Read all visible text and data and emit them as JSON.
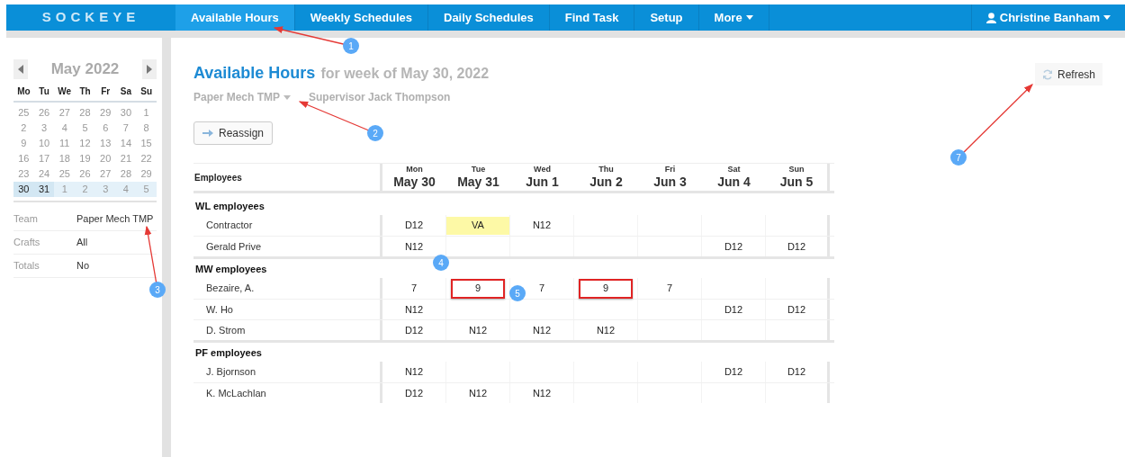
{
  "brand": "SOCKEYE",
  "nav": [
    {
      "label": "Available Hours",
      "selected": true
    },
    {
      "label": "Weekly Schedules",
      "selected": false
    },
    {
      "label": "Daily Schedules",
      "selected": false
    },
    {
      "label": "Find Task",
      "selected": false
    },
    {
      "label": "Setup",
      "selected": false
    },
    {
      "label": "More",
      "selected": false,
      "dropdown": true
    }
  ],
  "user": {
    "name": "Christine Banham"
  },
  "calendar": {
    "month": "May 2022",
    "weekdays": [
      "Mo",
      "Tu",
      "We",
      "Th",
      "Fr",
      "Sa",
      "Su"
    ],
    "weeks": [
      {
        "selected": false,
        "days": [
          {
            "text": "25",
            "emphasized": false
          },
          {
            "text": "26",
            "emphasized": false
          },
          {
            "text": "27",
            "emphasized": false
          },
          {
            "text": "28",
            "emphasized": false
          },
          {
            "text": "29",
            "emphasized": false
          },
          {
            "text": "30",
            "emphasized": false
          },
          {
            "text": "1",
            "emphasized": false
          }
        ]
      },
      {
        "selected": false,
        "days": [
          {
            "text": "2",
            "emphasized": false
          },
          {
            "text": "3",
            "emphasized": false
          },
          {
            "text": "4",
            "emphasized": false
          },
          {
            "text": "5",
            "emphasized": false
          },
          {
            "text": "6",
            "emphasized": false
          },
          {
            "text": "7",
            "emphasized": false
          },
          {
            "text": "8",
            "emphasized": false
          }
        ]
      },
      {
        "selected": false,
        "days": [
          {
            "text": "9",
            "emphasized": false
          },
          {
            "text": "10",
            "emphasized": false
          },
          {
            "text": "11",
            "emphasized": false
          },
          {
            "text": "12",
            "emphasized": false
          },
          {
            "text": "13",
            "emphasized": false
          },
          {
            "text": "14",
            "emphasized": false
          },
          {
            "text": "15",
            "emphasized": false
          }
        ]
      },
      {
        "selected": false,
        "days": [
          {
            "text": "16",
            "emphasized": false
          },
          {
            "text": "17",
            "emphasized": false
          },
          {
            "text": "18",
            "emphasized": false
          },
          {
            "text": "19",
            "emphasized": false
          },
          {
            "text": "20",
            "emphasized": false
          },
          {
            "text": "21",
            "emphasized": false
          },
          {
            "text": "22",
            "emphasized": false
          }
        ]
      },
      {
        "selected": false,
        "days": [
          {
            "text": "23",
            "emphasized": false
          },
          {
            "text": "24",
            "emphasized": false
          },
          {
            "text": "25",
            "emphasized": false
          },
          {
            "text": "26",
            "emphasized": false
          },
          {
            "text": "27",
            "emphasized": false
          },
          {
            "text": "28",
            "emphasized": false
          },
          {
            "text": "29",
            "emphasized": false
          }
        ]
      },
      {
        "selected": true,
        "days": [
          {
            "text": "30",
            "emphasized": true
          },
          {
            "text": "31",
            "emphasized": true
          },
          {
            "text": "1",
            "emphasized": false
          },
          {
            "text": "2",
            "emphasized": false
          },
          {
            "text": "3",
            "emphasized": false
          },
          {
            "text": "4",
            "emphasized": false
          },
          {
            "text": "5",
            "emphasized": false
          }
        ]
      }
    ]
  },
  "filters": [
    {
      "label": "Team",
      "value": "Paper Mech TMP"
    },
    {
      "label": "Crafts",
      "value": "All"
    },
    {
      "label": "Totals",
      "value": "No"
    }
  ],
  "page": {
    "title": "Available Hours",
    "subtitle": "for week of May 30, 2022",
    "team": "Paper Mech TMP",
    "supervisor": "Supervisor Jack Thompson"
  },
  "reassign_button": "Reassign",
  "refresh_button": "Refresh",
  "table": {
    "name_column": "Employees",
    "days": [
      {
        "weekday": "Mon",
        "date": "May 30"
      },
      {
        "weekday": "Tue",
        "date": "May 31"
      },
      {
        "weekday": "Wed",
        "date": "Jun 1"
      },
      {
        "weekday": "Thu",
        "date": "Jun 2"
      },
      {
        "weekday": "Fri",
        "date": "Jun 3"
      },
      {
        "weekday": "Sat",
        "date": "Jun 4"
      },
      {
        "weekday": "Sun",
        "date": "Jun 5"
      }
    ],
    "groups": [
      {
        "name": "WL employees",
        "rows": [
          {
            "name": "Contractor",
            "cells": [
              {
                "text": "D12",
                "highlighted": false,
                "outlined": false
              },
              {
                "text": "VA",
                "highlighted": true,
                "outlined": false
              },
              {
                "text": "N12",
                "highlighted": false,
                "outlined": false
              },
              null,
              null,
              null,
              null
            ]
          },
          {
            "name": "Gerald Prive",
            "cells": [
              {
                "text": "N12",
                "highlighted": false,
                "outlined": false
              },
              null,
              null,
              null,
              null,
              {
                "text": "D12",
                "highlighted": false,
                "outlined": false
              },
              {
                "text": "D12",
                "highlighted": false,
                "outlined": false
              }
            ]
          }
        ]
      },
      {
        "name": "MW employees",
        "rows": [
          {
            "name": "Bezaire, A.",
            "cells": [
              {
                "text": "7",
                "highlighted": false,
                "outlined": false
              },
              {
                "text": "9",
                "highlighted": false,
                "outlined": true
              },
              {
                "text": "7",
                "highlighted": false,
                "outlined": false
              },
              {
                "text": "9",
                "highlighted": false,
                "outlined": true
              },
              {
                "text": "7",
                "highlighted": false,
                "outlined": false
              },
              null,
              null
            ]
          },
          {
            "name": "W. Ho",
            "cells": [
              {
                "text": "N12",
                "highlighted": false,
                "outlined": false
              },
              null,
              null,
              null,
              null,
              {
                "text": "D12",
                "highlighted": false,
                "outlined": false
              },
              {
                "text": "D12",
                "highlighted": false,
                "outlined": false
              }
            ]
          },
          {
            "name": "D. Strom",
            "cells": [
              {
                "text": "D12",
                "highlighted": false,
                "outlined": false
              },
              {
                "text": "N12",
                "highlighted": false,
                "outlined": false
              },
              {
                "text": "N12",
                "highlighted": false,
                "outlined": false
              },
              {
                "text": "N12",
                "highlighted": false,
                "outlined": false
              },
              null,
              null,
              null
            ]
          }
        ]
      },
      {
        "name": "PF employees",
        "rows": [
          {
            "name": "J. Bjornson",
            "cells": [
              {
                "text": "N12",
                "highlighted": false,
                "outlined": false
              },
              null,
              null,
              null,
              null,
              {
                "text": "D12",
                "highlighted": false,
                "outlined": false
              },
              {
                "text": "D12",
                "highlighted": false,
                "outlined": false
              }
            ]
          },
          {
            "name": "K. McLachlan",
            "cells": [
              {
                "text": "D12",
                "highlighted": false,
                "outlined": false
              },
              {
                "text": "N12",
                "highlighted": false,
                "outlined": false
              },
              {
                "text": "N12",
                "highlighted": false,
                "outlined": false
              },
              null,
              null,
              null,
              null
            ]
          }
        ]
      }
    ]
  },
  "annotations": [
    {
      "text": "1"
    },
    {
      "text": "2"
    },
    {
      "text": "3"
    },
    {
      "text": "4"
    },
    {
      "text": "5"
    },
    {
      "text": "7"
    }
  ]
}
